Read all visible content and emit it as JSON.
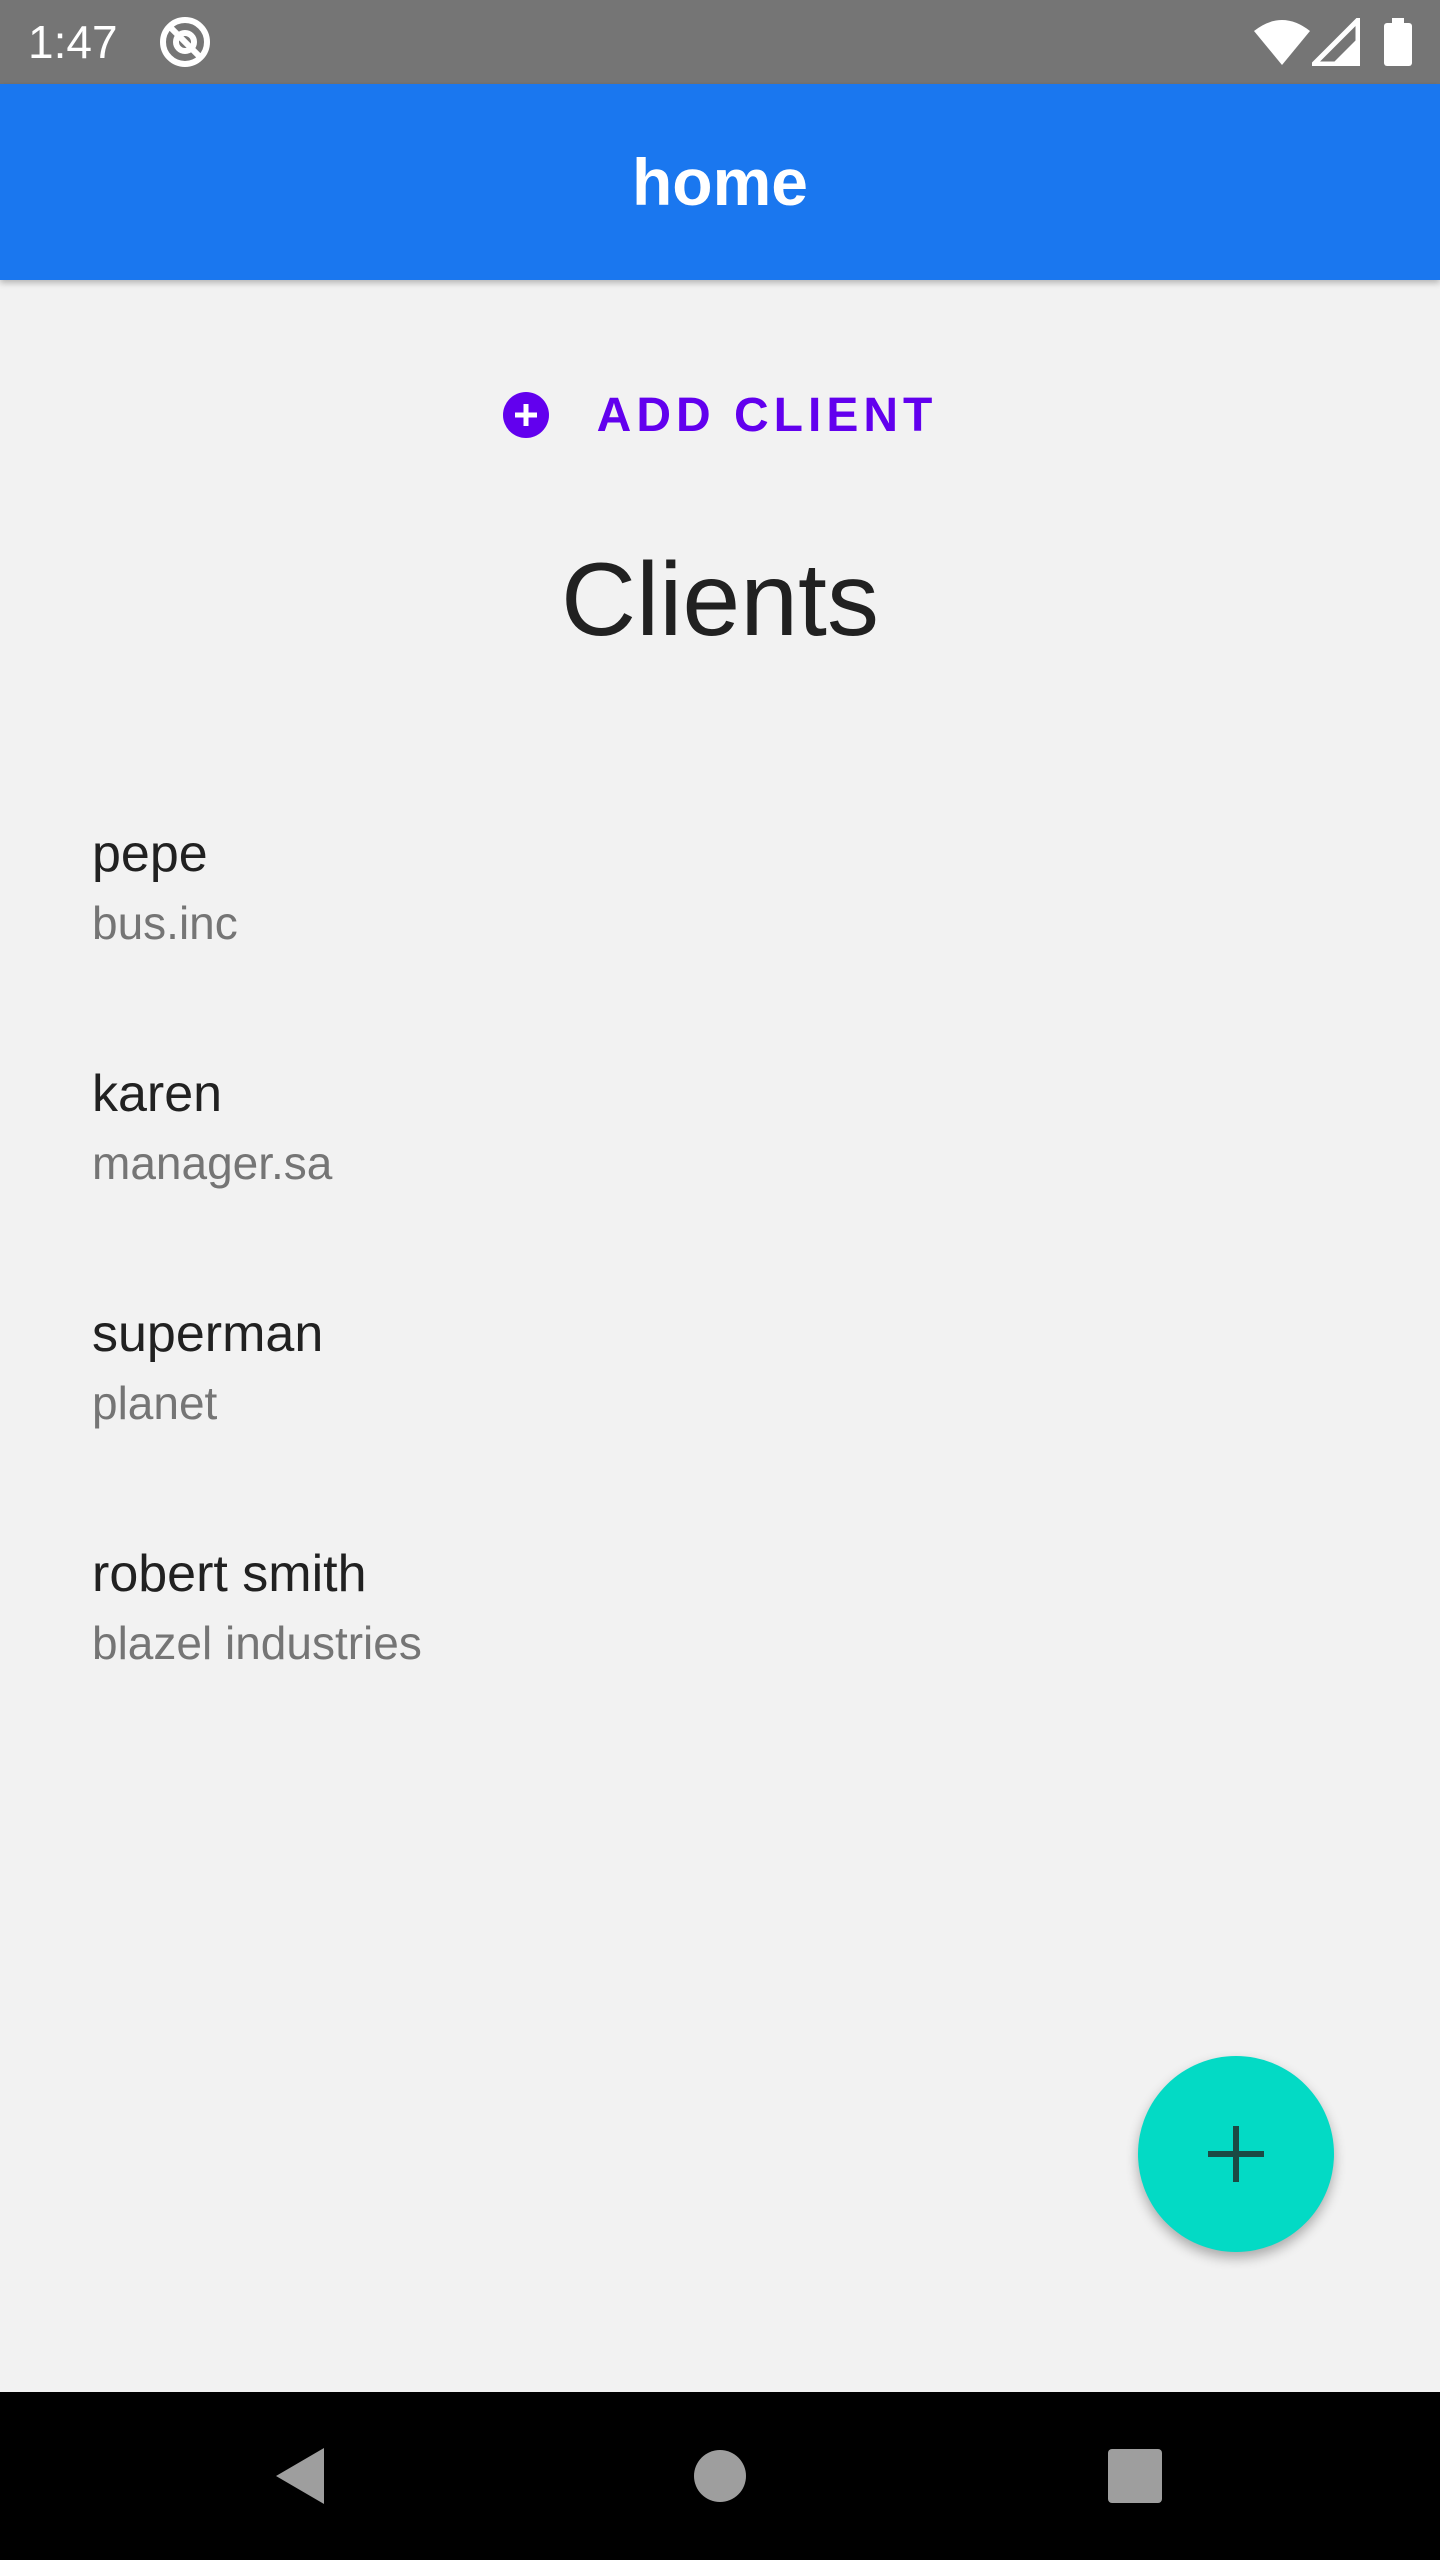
{
  "status_bar": {
    "time": "1:47",
    "icons": [
      "at-sign-icon",
      "wifi-icon",
      "signal-icon",
      "battery-icon"
    ]
  },
  "app_bar": {
    "title": "home",
    "color": "#1a77ef"
  },
  "add_client": {
    "icon": "add-circle-icon",
    "label": "ADD CLIENT",
    "color": "#6200ee"
  },
  "heading": "Clients",
  "clients": [
    {
      "name": "pepe",
      "company": "bus.inc"
    },
    {
      "name": "karen",
      "company": "manager.sa"
    },
    {
      "name": "superman",
      "company": "planet"
    },
    {
      "name": "robert smith",
      "company": "blazel industries"
    }
  ],
  "fab": {
    "icon": "plus-icon",
    "color": "#03dac5"
  },
  "nav_bar": {
    "icons": [
      "back-icon",
      "home-icon",
      "recents-icon"
    ]
  }
}
